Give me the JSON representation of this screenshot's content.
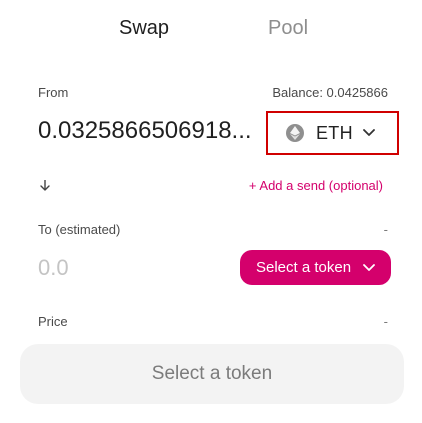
{
  "tabs": {
    "swap": "Swap",
    "pool": "Pool"
  },
  "from": {
    "label": "From",
    "balance": "Balance: 0.0425866",
    "amount": "0.0325866506918...",
    "token": "ETH"
  },
  "add_send": "+ Add a send (optional)",
  "to": {
    "label": "To (estimated)",
    "balance": "-",
    "amount_placeholder": "0.0",
    "select_token_label": "Select a token"
  },
  "price": {
    "label": "Price",
    "value": "-"
  },
  "bottom_button": "Select a token",
  "colors": {
    "accent": "#d4006c",
    "highlight_border": "#d00000"
  },
  "icons": {
    "eth": "eth-icon",
    "swap_arrow": "arrow-down-icon",
    "chevron": "chevron-down-icon"
  }
}
